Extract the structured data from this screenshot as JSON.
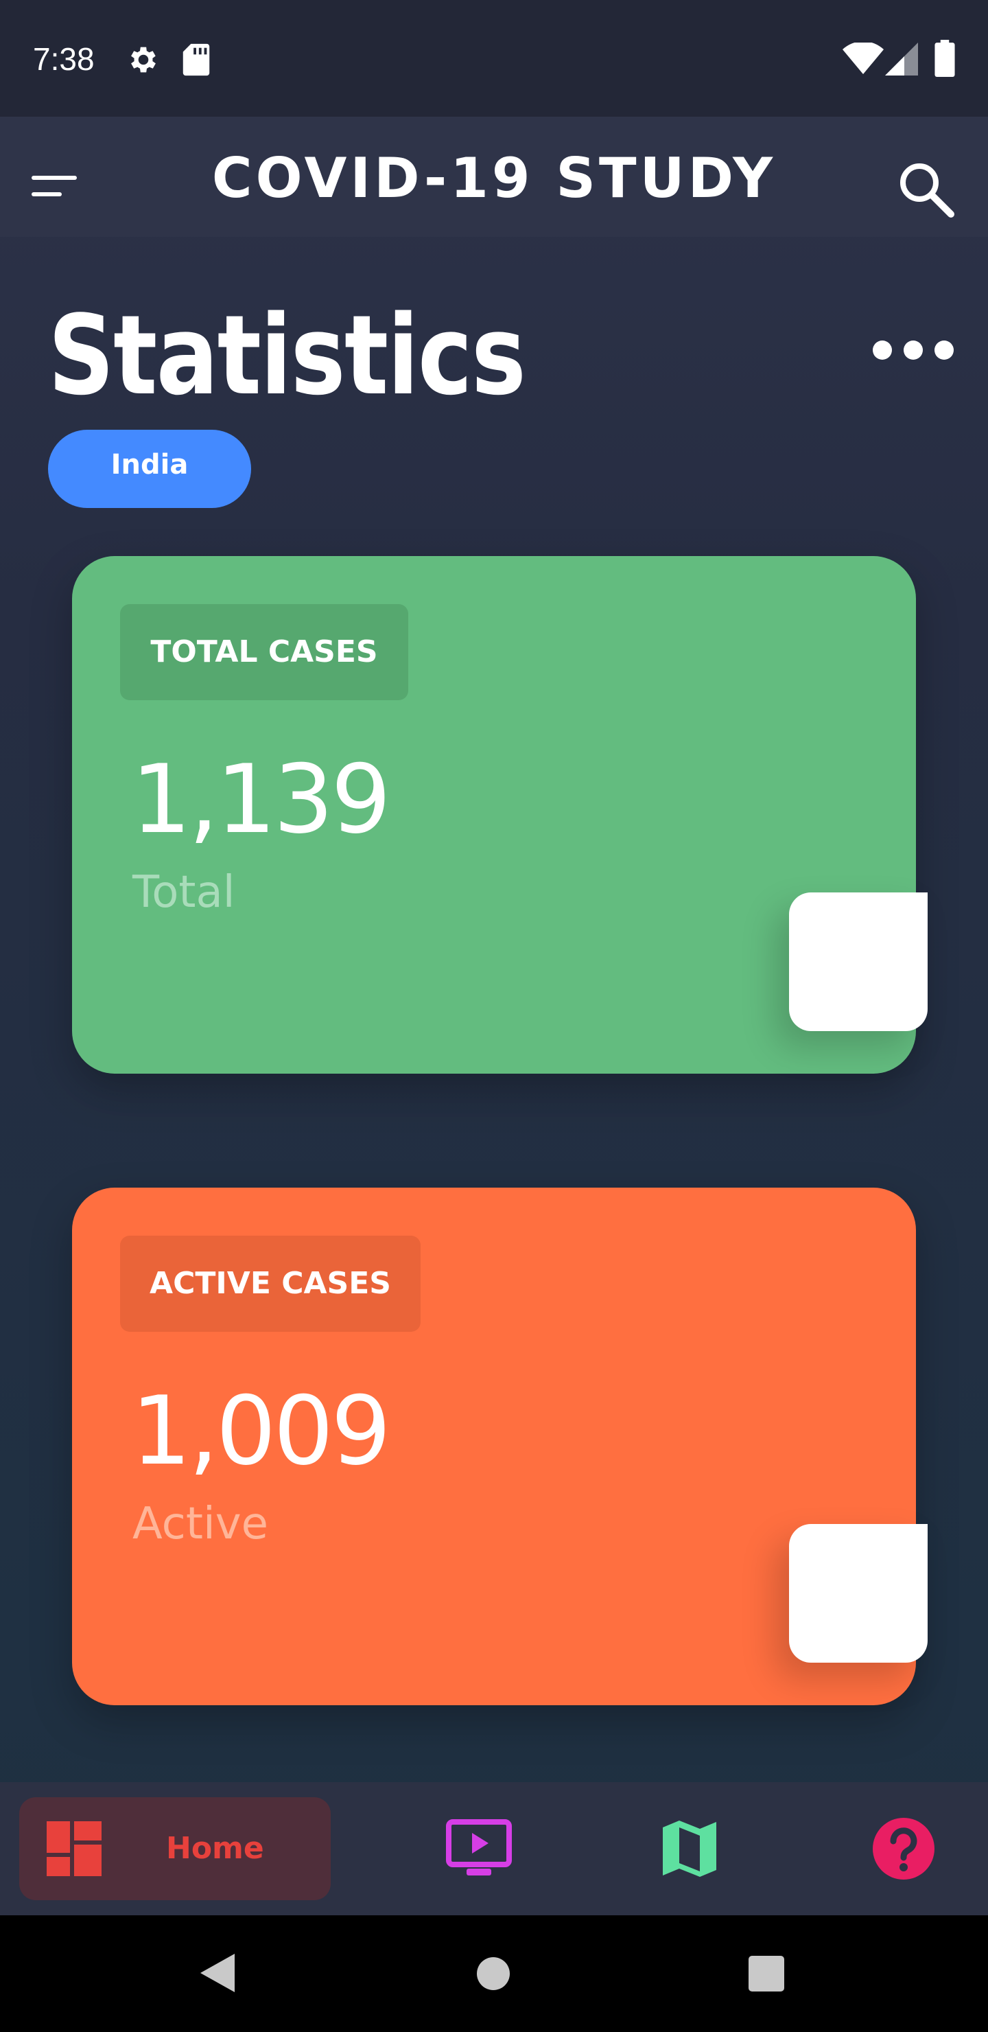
{
  "status_bar": {
    "time": "7:38",
    "icons": [
      "settings-gear-icon",
      "sd-card-icon",
      "wifi-icon",
      "cell-signal-icon",
      "battery-icon"
    ]
  },
  "app_bar": {
    "title": "COVID-19 STUDY",
    "menu_icon": "menu-icon",
    "search_icon": "search-icon"
  },
  "page": {
    "heading": "Statistics",
    "more_icon": "more-horizontal-icon",
    "country": "India"
  },
  "cards": [
    {
      "tag": "TOTAL CASES",
      "value": "1,139",
      "sub": "Total",
      "color": "#63bc7f",
      "tag_color": "#56a86f"
    },
    {
      "tag": "ACTIVE CASES",
      "value": "1,009",
      "sub": "Active",
      "color": "#ff6f40",
      "tag_color": "#ea6439"
    }
  ],
  "bottom_nav": {
    "items": [
      {
        "label": "Home",
        "icon": "dashboard-icon",
        "active": true,
        "color": "#e8413c"
      },
      {
        "label": "",
        "icon": "video-play-icon",
        "active": false,
        "color": "#d63ee6"
      },
      {
        "label": "",
        "icon": "map-icon",
        "active": false,
        "color": "#5ee0a0"
      },
      {
        "label": "",
        "icon": "help-icon",
        "active": false,
        "color": "#e91e63"
      }
    ]
  },
  "system_nav": {
    "icons": [
      "back-icon",
      "home-circle-icon",
      "recent-apps-icon"
    ]
  }
}
